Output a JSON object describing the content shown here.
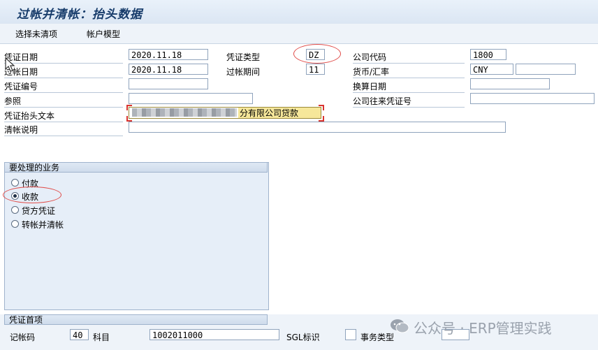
{
  "window": {
    "title": "过帐并清帐：抬头数据"
  },
  "toolbar": {
    "select_open_items": "选择未清项",
    "account_model": "帐户模型"
  },
  "header": {
    "doc_date": {
      "label": "凭证日期",
      "value": "2020.11.18"
    },
    "doc_type": {
      "label": "凭证类型",
      "value": "DZ"
    },
    "company_code": {
      "label": "公司代码",
      "value": "1800"
    },
    "posting_date": {
      "label": "过帐日期",
      "value": "2020.11.18"
    },
    "period": {
      "label": "过帐期间",
      "value": "11"
    },
    "currency": {
      "label": "货币/汇率",
      "value": "CNY",
      "rate": ""
    },
    "doc_number": {
      "label": "凭证编号",
      "value": ""
    },
    "translation_date": {
      "label": "换算日期",
      "value": ""
    },
    "reference": {
      "label": "参照",
      "value": ""
    },
    "intercompany_doc": {
      "label": "公司往来凭证号",
      "value": ""
    },
    "header_text": {
      "label": "凭证抬头文本",
      "value_visible": "分有限公司贷款"
    },
    "clearing_text": {
      "label": "清帐说明",
      "value": ""
    }
  },
  "transaction_group": {
    "title": "要处理的业务",
    "options": [
      {
        "label": "付款",
        "selected": false
      },
      {
        "label": "收款",
        "selected": true
      },
      {
        "label": "贷方凭证",
        "selected": false
      },
      {
        "label": "转帐并清帐",
        "selected": false
      }
    ]
  },
  "first_line_item": {
    "title": "凭证首项",
    "posting_key": {
      "label": "记帐码",
      "value": "40"
    },
    "account": {
      "label": "科目",
      "value": "1002011000"
    },
    "sgl": {
      "label": "SGL标识",
      "value": ""
    },
    "transaction_type": {
      "label": "事务类型",
      "value": ""
    }
  },
  "watermark": {
    "text": "公众号 · ERP管理实践"
  },
  "colors": {
    "title_bg": "#dbe6f3",
    "annotation_red": "#e04b48",
    "highlight_yellow": "#f6e79a"
  }
}
